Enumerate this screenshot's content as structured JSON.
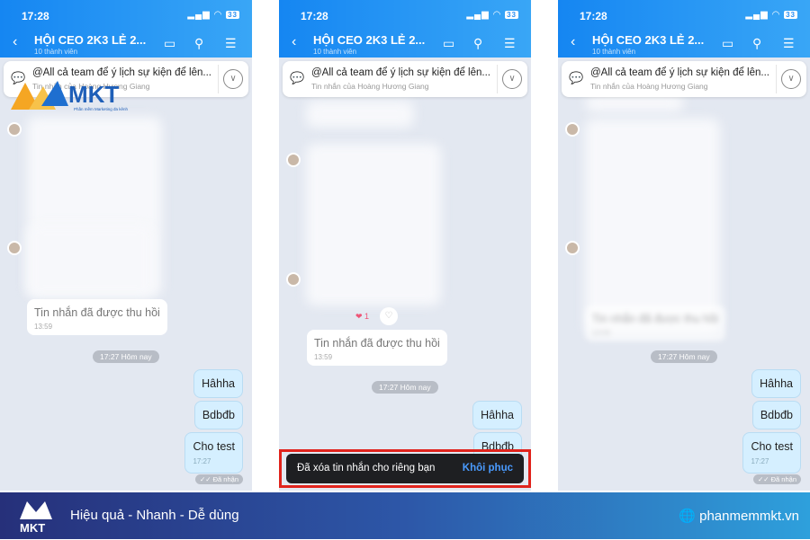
{
  "status": {
    "time": "17:28",
    "battery": "33"
  },
  "header": {
    "title": "HỘI CEO 2K3 LẺ 2...",
    "subtitle": "10 thành viên"
  },
  "pinned": {
    "text": "@All cả team để ý lịch sự kiện để lên...",
    "sender": "Tin nhắn của Hoàng Hương Giang"
  },
  "messages": {
    "recalled": "Tin nhắn đã được thu hồi",
    "recalled_time": "13:59",
    "time_pill": "17:27 Hôm nay",
    "sent": [
      "Hâhha",
      "Bdbđb",
      "Cho test"
    ],
    "sent_time": "17:27",
    "received": "Đã nhận",
    "reaction_count": "1"
  },
  "toast": {
    "message": "Đã xóa tin nhắn cho riêng bạn",
    "action": "Khôi phục"
  },
  "logo": {
    "text": "MKT",
    "tagline": "Phần mềm Marketing đa kênh"
  },
  "banner": {
    "slogan": "Hiệu quả - Nhanh  - Dễ dùng",
    "website": "phanmemmkt.vn"
  },
  "colors": {
    "header": "#1586f2",
    "toast_border": "#e0231c",
    "toast_action": "#4a9bff",
    "bubble": "#d5efff"
  }
}
